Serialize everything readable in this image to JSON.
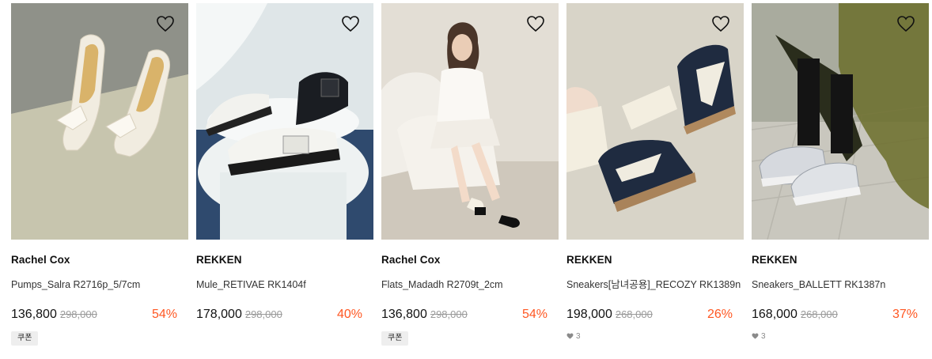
{
  "products": [
    {
      "brand": "Rachel Cox",
      "name": "Pumps_Salra R2716p_5/7cm",
      "price": "136,800",
      "original_price": "298,000",
      "discount": "54%",
      "coupon": "쿠폰",
      "likes": "",
      "image": "white-bow-mule-heels"
    },
    {
      "brand": "REKKEN",
      "name": "Mule_RETIVAE RK1404f",
      "price": "178,000",
      "original_price": "298,000",
      "discount": "40%",
      "coupon": "",
      "likes": "",
      "image": "buckle-mules-on-stool"
    },
    {
      "brand": "Rachel Cox",
      "name": "Flats_Madadh R2709t_2cm",
      "price": "136,800",
      "original_price": "298,000",
      "discount": "54%",
      "coupon": "쿠폰",
      "likes": "",
      "image": "model-seated-flats"
    },
    {
      "brand": "REKKEN",
      "name": "Sneakers[남녀공용]_RECOZY RK1389n",
      "price": "198,000",
      "original_price": "268,000",
      "discount": "26%",
      "coupon": "",
      "likes": "3",
      "image": "navy-sneakers-socks"
    },
    {
      "brand": "REKKEN",
      "name": "Sneakers_BALLETT RK1387n",
      "price": "168,000",
      "original_price": "268,000",
      "discount": "37%",
      "coupon": "",
      "likes": "3",
      "image": "silver-sneakers"
    }
  ],
  "icons": {
    "wishlist": "heart-outline-icon",
    "likes": "heart-filled-icon"
  },
  "colors": {
    "discount": "#ff5722",
    "strike": "#9a9a9a",
    "coupon_bg": "#eeeeee"
  }
}
